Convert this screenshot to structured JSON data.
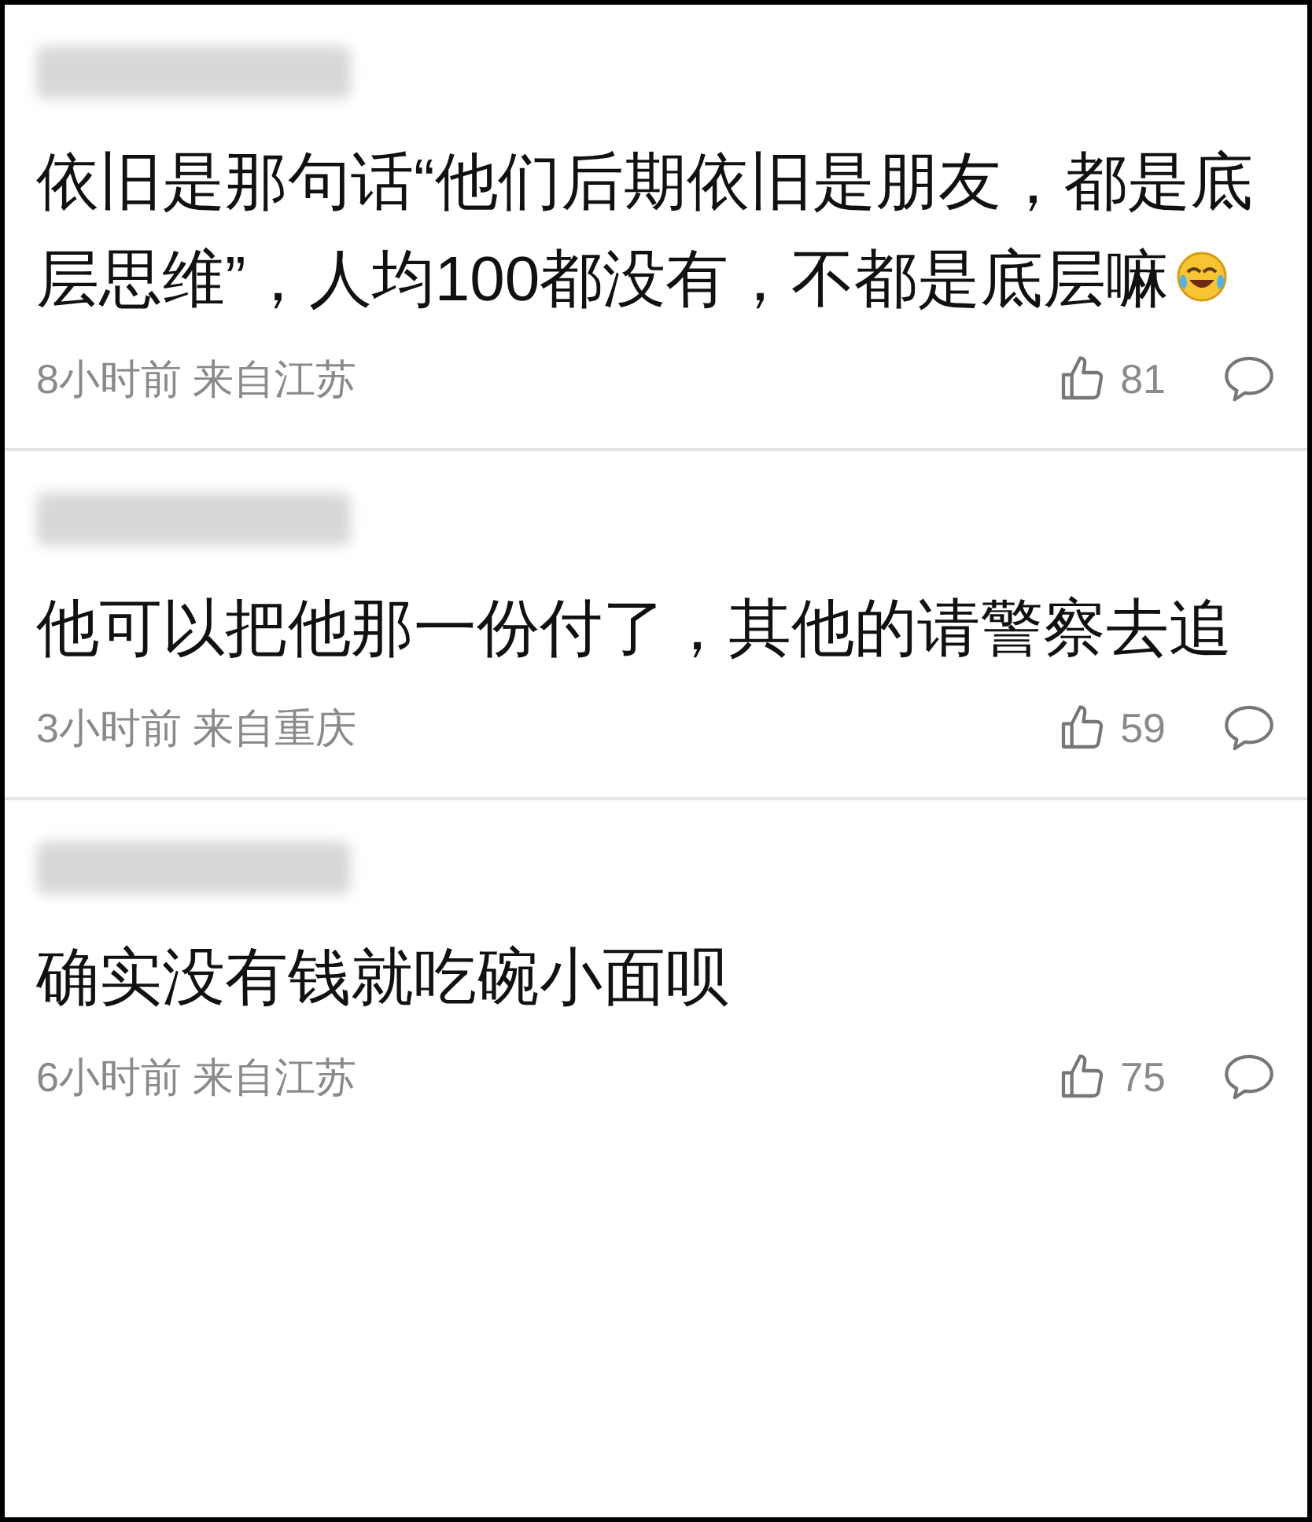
{
  "comments": [
    {
      "text": "依旧是那句话“他们后期依旧是朋友，都是底层思维”，人均100都没有，不都是底层嘛",
      "has_emoji": true,
      "time": "8小时前",
      "location": "来自江苏",
      "likes": "81"
    },
    {
      "text": "他可以把他那一份付了，其他的请警察去追",
      "has_emoji": false,
      "time": "3小时前",
      "location": "来自重庆",
      "likes": "59"
    },
    {
      "text": "确实没有钱就吃碗小面呗",
      "has_emoji": false,
      "time": "6小时前",
      "location": "来自江苏",
      "likes": "75"
    }
  ]
}
